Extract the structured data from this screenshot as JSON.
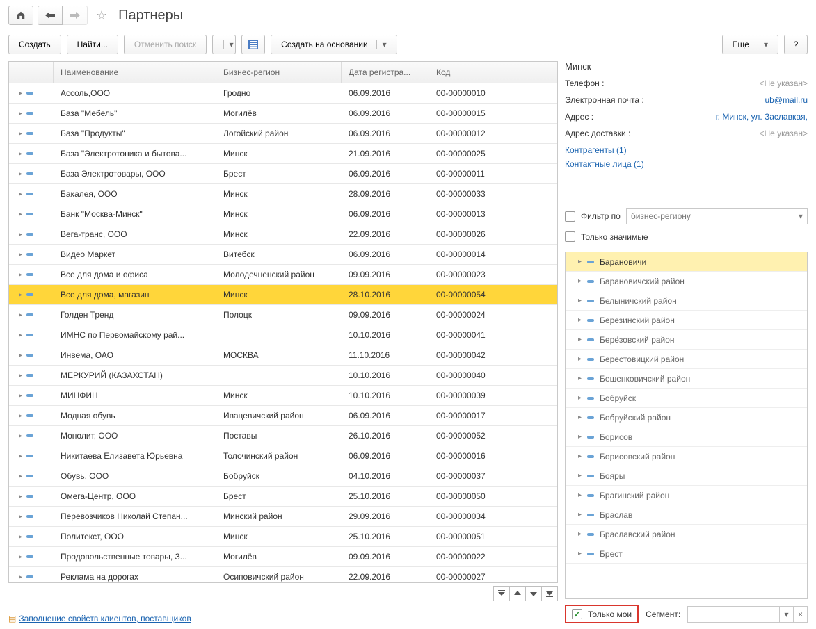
{
  "page_title": "Партнеры",
  "toolbar": {
    "create": "Создать",
    "find": "Найти...",
    "cancel_search": "Отменить поиск",
    "create_based_on": "Создать на основании",
    "more": "Еще",
    "help": "?"
  },
  "columns": {
    "name": "Наименование",
    "region": "Бизнес-регион",
    "date": "Дата регистра...",
    "code": "Код"
  },
  "rows": [
    {
      "name": "Ассоль,ООО",
      "region": "Гродно",
      "date": "06.09.2016",
      "code": "00-00000010"
    },
    {
      "name": "База \"Мебель\"",
      "region": "Могилёв",
      "date": "06.09.2016",
      "code": "00-00000015"
    },
    {
      "name": "База \"Продукты\"",
      "region": "Логойский район",
      "date": "06.09.2016",
      "code": "00-00000012"
    },
    {
      "name": "База \"Электротоника и бытова...",
      "region": "Минск",
      "date": "21.09.2016",
      "code": "00-00000025"
    },
    {
      "name": "База Электротовары, ООО",
      "region": "Брест",
      "date": "06.09.2016",
      "code": "00-00000011"
    },
    {
      "name": "Бакалея, ООО",
      "region": "Минск",
      "date": "28.09.2016",
      "code": "00-00000033"
    },
    {
      "name": "Банк \"Москва-Минск\"",
      "region": "Минск",
      "date": "06.09.2016",
      "code": "00-00000013"
    },
    {
      "name": "Вега-транс, ООО",
      "region": "Минск",
      "date": "22.09.2016",
      "code": "00-00000026"
    },
    {
      "name": "Видео Маркет",
      "region": "Витебск",
      "date": "06.09.2016",
      "code": "00-00000014"
    },
    {
      "name": "Все для дома и офиса",
      "region": "Молодечненский район",
      "date": "09.09.2016",
      "code": "00-00000023"
    },
    {
      "name": "Все для дома, магазин",
      "region": "Минск",
      "date": "28.10.2016",
      "code": "00-00000054",
      "selected": true
    },
    {
      "name": "Голден Тренд",
      "region": "Полоцк",
      "date": "09.09.2016",
      "code": "00-00000024"
    },
    {
      "name": "ИМНС по Первомайскому рай...",
      "region": "",
      "date": "10.10.2016",
      "code": "00-00000041"
    },
    {
      "name": "Инвема, ОАО",
      "region": "МОСКВА",
      "date": "11.10.2016",
      "code": "00-00000042"
    },
    {
      "name": "МЕРКУРИЙ (КАЗАХСТАН)",
      "region": "",
      "date": "10.10.2016",
      "code": "00-00000040"
    },
    {
      "name": "МИНФИН",
      "region": "Минск",
      "date": "10.10.2016",
      "code": "00-00000039"
    },
    {
      "name": "Модная обувь",
      "region": "Ивацевичский район",
      "date": "06.09.2016",
      "code": "00-00000017"
    },
    {
      "name": "Монолит, ООО",
      "region": "Поставы",
      "date": "26.10.2016",
      "code": "00-00000052"
    },
    {
      "name": "Никитаева Елизавета Юрьевна",
      "region": "Толочинский район",
      "date": "06.09.2016",
      "code": "00-00000016"
    },
    {
      "name": "Обувь, ООО",
      "region": "Бобруйск",
      "date": "04.10.2016",
      "code": "00-00000037"
    },
    {
      "name": "Омега-Центр, ООО",
      "region": "Брест",
      "date": "25.10.2016",
      "code": "00-00000050"
    },
    {
      "name": "Перевозчиков Николай Степан...",
      "region": "Минский район",
      "date": "29.09.2016",
      "code": "00-00000034"
    },
    {
      "name": "Политекст, ООО",
      "region": "Минск",
      "date": "25.10.2016",
      "code": "00-00000051"
    },
    {
      "name": "Продовольственные товары, З...",
      "region": "Могилёв",
      "date": "09.09.2016",
      "code": "00-00000022"
    },
    {
      "name": "Реклама на дорогах",
      "region": "Осиповичский район",
      "date": "22.09.2016",
      "code": "00-00000027"
    }
  ],
  "bottom_link": "Заполнение свойств клиентов, поставщиков",
  "detail": {
    "title": "Минск",
    "phone_label": "Телефон :",
    "phone_value": "<Не указан>",
    "email_label": "Электронная почта :",
    "email_value": "ub@mail.ru",
    "address_label": "Адрес :",
    "address_value": "г. Минск, ул. Заславкая,",
    "delivery_label": "Адрес доставки :",
    "delivery_value": "<Не указан>",
    "contractors": "Контрагенты (1)",
    "contacts": "Контактные лица (1)"
  },
  "filters": {
    "filter_by": "Фильтр по",
    "filter_by_value": "бизнес-региону",
    "only_significant": "Только значимые",
    "only_mine": "Только мои",
    "segment_label": "Сегмент:"
  },
  "regions": [
    {
      "name": "Барановичи",
      "selected": true
    },
    {
      "name": "Барановичский район"
    },
    {
      "name": "Белыничский район"
    },
    {
      "name": "Березинский район"
    },
    {
      "name": "Берёзовский район"
    },
    {
      "name": "Берестовицкий район"
    },
    {
      "name": "Бешенковичский район"
    },
    {
      "name": "Бобруйск"
    },
    {
      "name": "Бобруйский район"
    },
    {
      "name": "Борисов"
    },
    {
      "name": "Борисовский район"
    },
    {
      "name": "Бояры"
    },
    {
      "name": "Брагинский район"
    },
    {
      "name": "Браслав"
    },
    {
      "name": "Браславский район"
    },
    {
      "name": "Брест"
    }
  ]
}
